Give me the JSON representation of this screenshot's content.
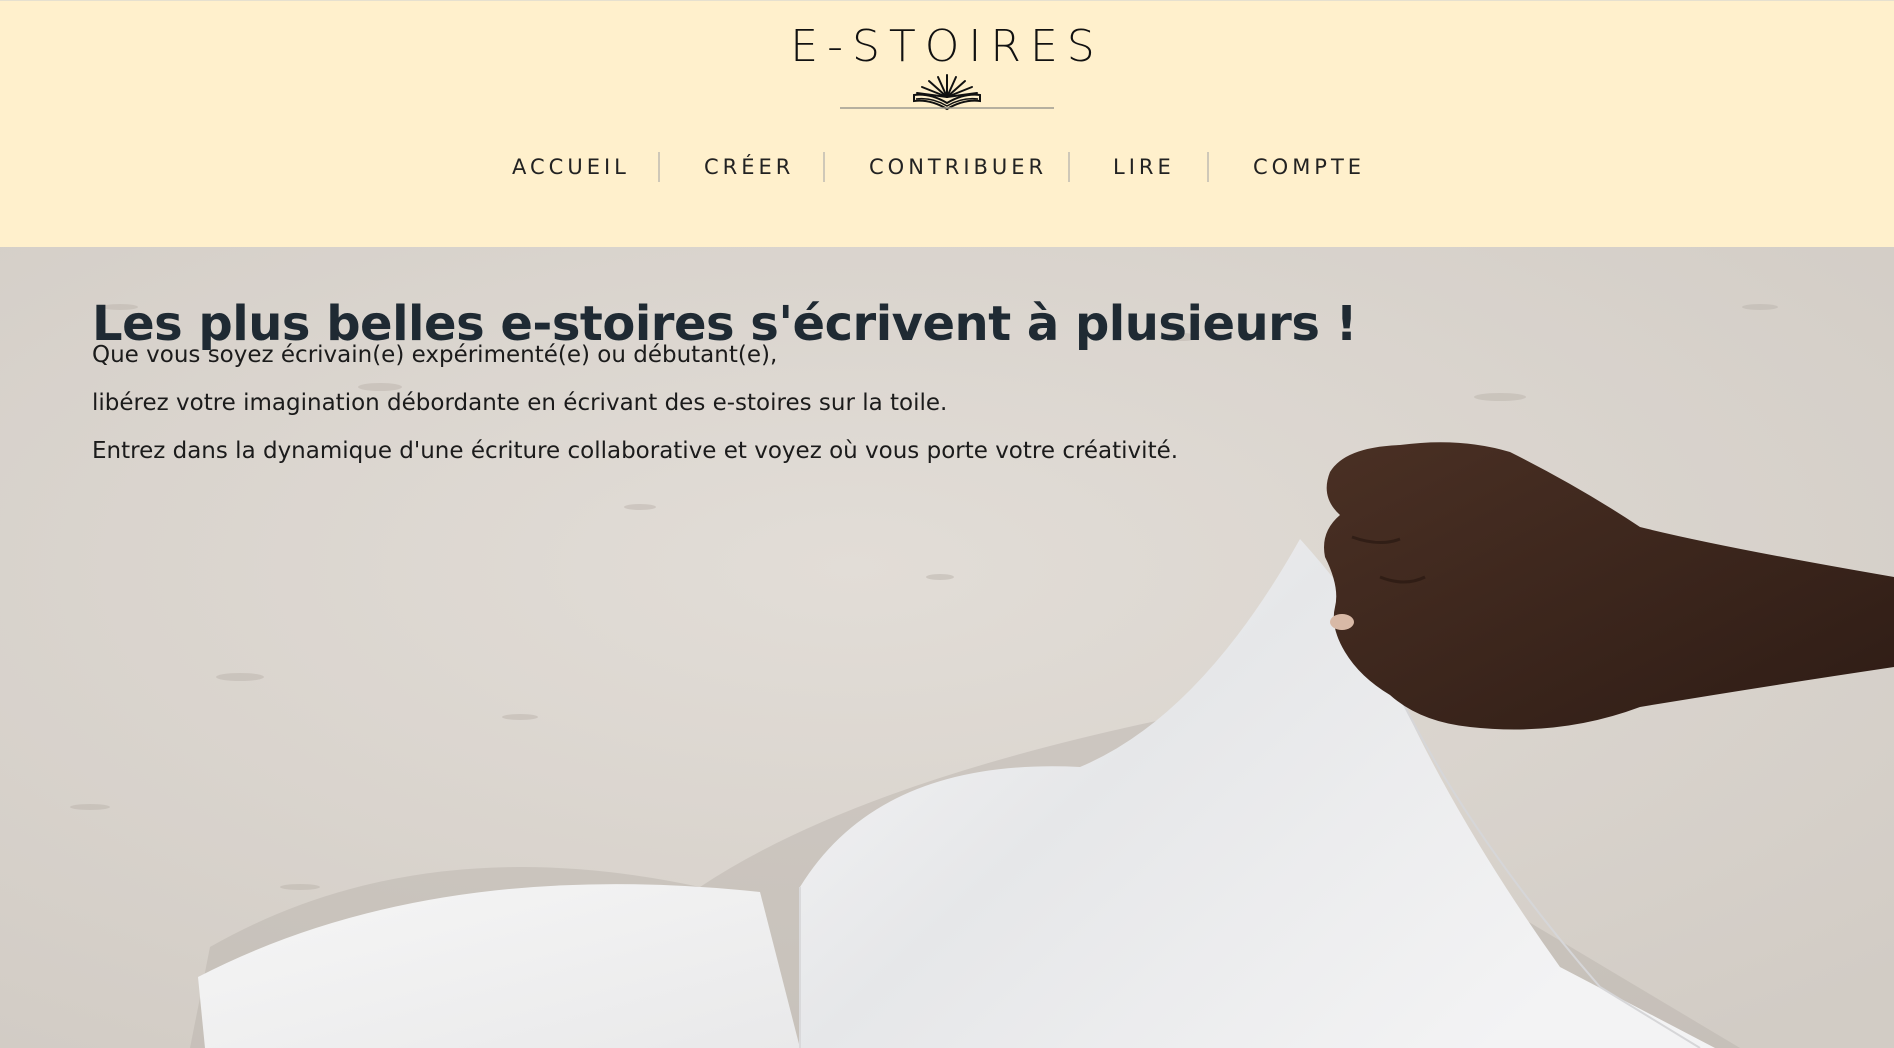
{
  "brand": {
    "name": "E-STOIRES"
  },
  "nav": {
    "items": [
      {
        "label": "ACCUEIL"
      },
      {
        "label": "CRÉER"
      },
      {
        "label": "CONTRIBUER"
      },
      {
        "label": "LIRE"
      },
      {
        "label": "COMPTE"
      }
    ]
  },
  "hero": {
    "title": "Les plus belles e-stoires s'écrivent à plusieurs !",
    "lines": [
      "Que vous soyez écrivain(e) expérimenté(e) ou débutant(e),",
      "libérez votre imagination débordante en écrivant des e-stoires sur la toile.",
      "Entrez dans la dynamique d'une écriture collaborative et voyez où vous porte votre créativité."
    ]
  },
  "colors": {
    "header_bg": "#fff0cc",
    "title": "#1f2a33",
    "text": "#1b1b1b"
  },
  "icons": {
    "logo": "open-book-icon"
  }
}
